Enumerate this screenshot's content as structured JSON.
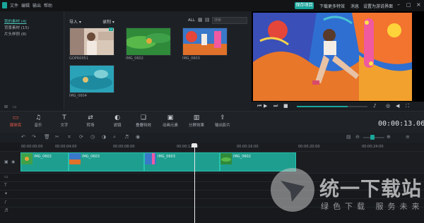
{
  "menu": [
    "文件",
    "编辑",
    "输出",
    "帮助"
  ],
  "title_actions": {
    "export": "保存项目",
    "download": "下载更多特效",
    "message": "消息",
    "settings": "设置为游说界面"
  },
  "library": {
    "sidebar": [
      "我的素材 (4)",
      "背景素材 (15)",
      "片头样例 (8)"
    ],
    "import_label": "导入",
    "record_label": "录制",
    "filter_label": "ALL",
    "search_placeholder": "搜索",
    "thumbs": [
      {
        "label": "GOPR0051"
      },
      {
        "label": "IMG_0602"
      },
      {
        "label": "IMG_0603"
      },
      {
        "label": "IMG_0604"
      }
    ]
  },
  "toolbar": [
    {
      "icon": "folder-icon",
      "label": "媒体库"
    },
    {
      "icon": "music-icon",
      "label": "音乐"
    },
    {
      "icon": "text-icon",
      "label": "文字"
    },
    {
      "icon": "transition-icon",
      "label": "转场"
    },
    {
      "icon": "filter-icon",
      "label": "滤镜"
    },
    {
      "icon": "overlay-icon",
      "label": "叠覆特效"
    },
    {
      "icon": "animation-icon",
      "label": "动画元素"
    },
    {
      "icon": "split-icon",
      "label": "分屏效果"
    },
    {
      "icon": "export-icon",
      "label": "输出影片"
    }
  ],
  "timecode": "00:00:13.06",
  "ruler_ticks": [
    "00:00:00:00",
    "00:00:04:00",
    "00:00:08:00",
    "00:00:12:00",
    "00:00:16:00",
    "00:00:20:00",
    "00:00:24:00"
  ],
  "clips": [
    "IMG_0602",
    "IMG_0603",
    "IMG_0603",
    "IMG_0602"
  ],
  "watermark": {
    "title": "统一下载站",
    "subtitle": "绿色下载  服务未来"
  },
  "colors": {
    "accent": "#1aa59a",
    "active_tool": "#e65a4a",
    "clip": "#1e9e8f"
  }
}
